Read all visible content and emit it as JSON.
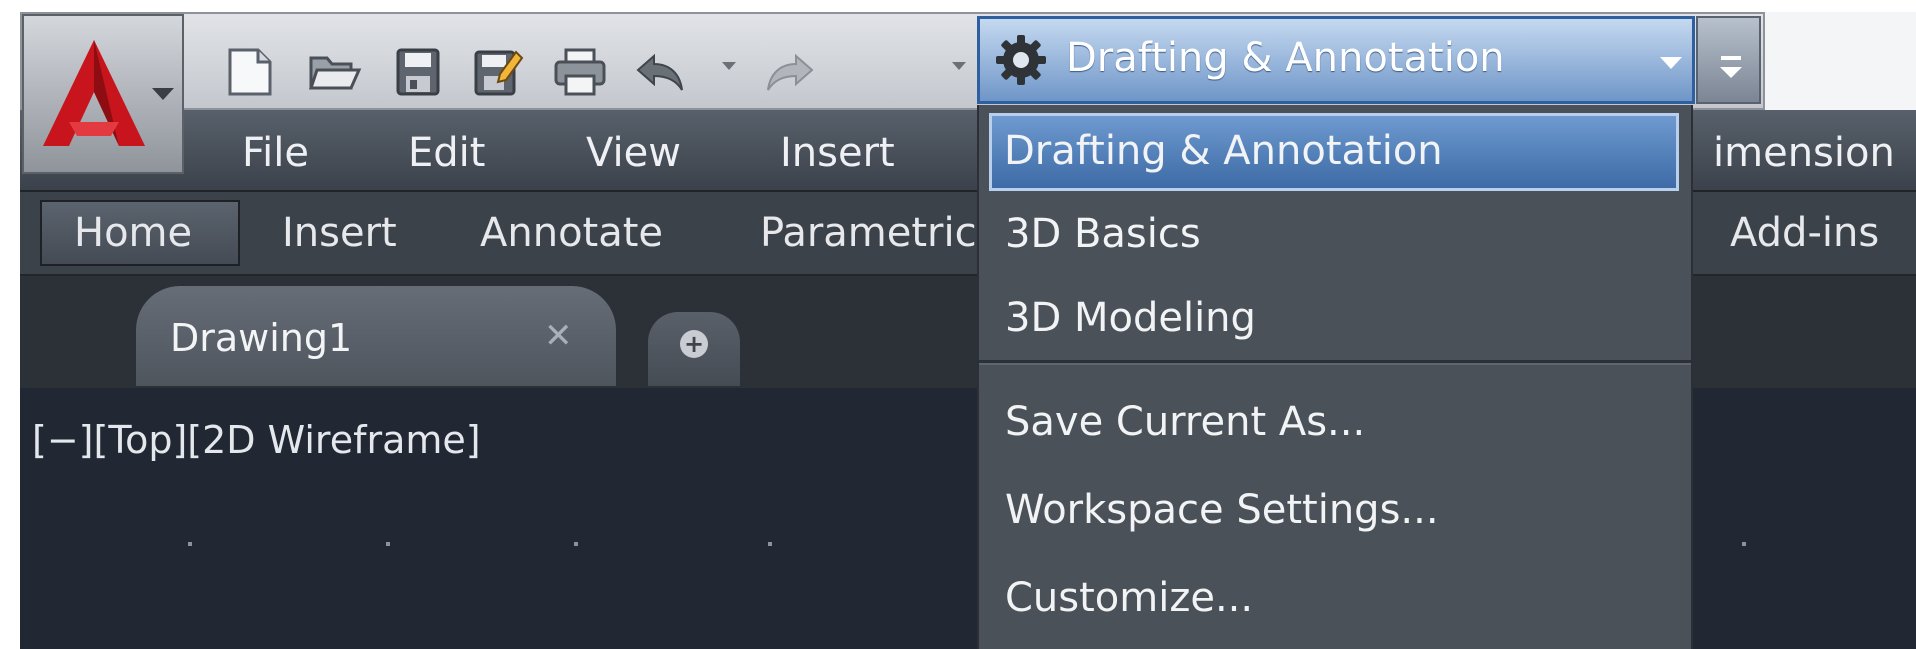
{
  "app": {
    "logo_icon": "autocad-logo-icon",
    "brand_color": "#c8141c"
  },
  "quick_access": {
    "icons": [
      "new-file-icon",
      "open-folder-icon",
      "save-icon",
      "save-as-icon",
      "print-icon",
      "undo-icon",
      "redo-icon"
    ]
  },
  "workspace": {
    "current": "Drafting & Annotation",
    "icon": "gear-icon"
  },
  "menubar": {
    "items": [
      "File",
      "Edit",
      "View",
      "Insert",
      "imension"
    ]
  },
  "ribbon": {
    "tabs": [
      "Home",
      "Insert",
      "Annotate",
      "Parametric",
      "Add-ins"
    ],
    "active": "Home"
  },
  "document": {
    "tab_label": "Drawing1",
    "close_glyph": "✕",
    "new_tab_glyph": "+"
  },
  "viewport": {
    "label": "[−][Top][2D Wireframe]"
  },
  "workspace_menu": {
    "items": [
      "Drafting & Annotation",
      "3D Basics",
      "3D Modeling"
    ],
    "actions": [
      "Save Current As...",
      "Workspace Settings...",
      "Customize..."
    ],
    "selected": "Drafting & Annotation"
  },
  "colors": {
    "selection": "#4a78b4",
    "canvas": "#212833"
  }
}
